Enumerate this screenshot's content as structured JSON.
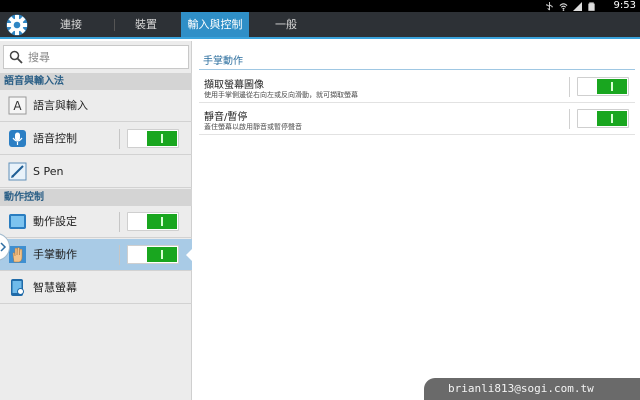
{
  "status_bar": {
    "time": "9:53",
    "icons": [
      "usb-icon",
      "wifi-icon",
      "signal-icon",
      "battery-icon"
    ]
  },
  "tabs": [
    {
      "label": "連接",
      "active": false
    },
    {
      "label": "裝置",
      "active": false
    },
    {
      "label": "輸入與控制",
      "active": true
    },
    {
      "label": "一般",
      "active": false
    }
  ],
  "sidebar": {
    "search": {
      "placeholder": "搜尋",
      "value": ""
    },
    "sections": [
      {
        "header": "語音與輸入法",
        "items": [
          {
            "label": "語言與輸入",
            "icon": "keyboard-icon",
            "toggle": null,
            "selected": false
          },
          {
            "label": "語音控制",
            "icon": "microphone-icon",
            "toggle": "on",
            "selected": false
          },
          {
            "label": "S Pen",
            "icon": "pen-icon",
            "toggle": null,
            "selected": false
          }
        ]
      },
      {
        "header": "動作控制",
        "items": [
          {
            "label": "動作設定",
            "icon": "tablet-icon",
            "toggle": "on",
            "selected": false
          },
          {
            "label": "手掌動作",
            "icon": "palm-icon",
            "toggle": "on",
            "selected": true
          },
          {
            "label": "智慧螢幕",
            "icon": "smart-screen-icon",
            "toggle": null,
            "selected": false
          }
        ]
      }
    ]
  },
  "content": {
    "title": "手掌動作",
    "settings": [
      {
        "title": "擷取螢幕圖像",
        "description": "使用手掌側邊從右向左或反向滑動，就可擷取螢幕",
        "toggle": "on"
      },
      {
        "title": "靜音/暫停",
        "description": "蓋住螢幕以啟用靜音或暫停聲音",
        "toggle": "on"
      }
    ]
  },
  "watermark": "brianli813@sogi.com.tw",
  "colors": {
    "accent": "#2f8fc7",
    "toggle_on": "#19a61f",
    "selected_bg": "#a9cbe6",
    "section_text": "#2b5f86"
  }
}
